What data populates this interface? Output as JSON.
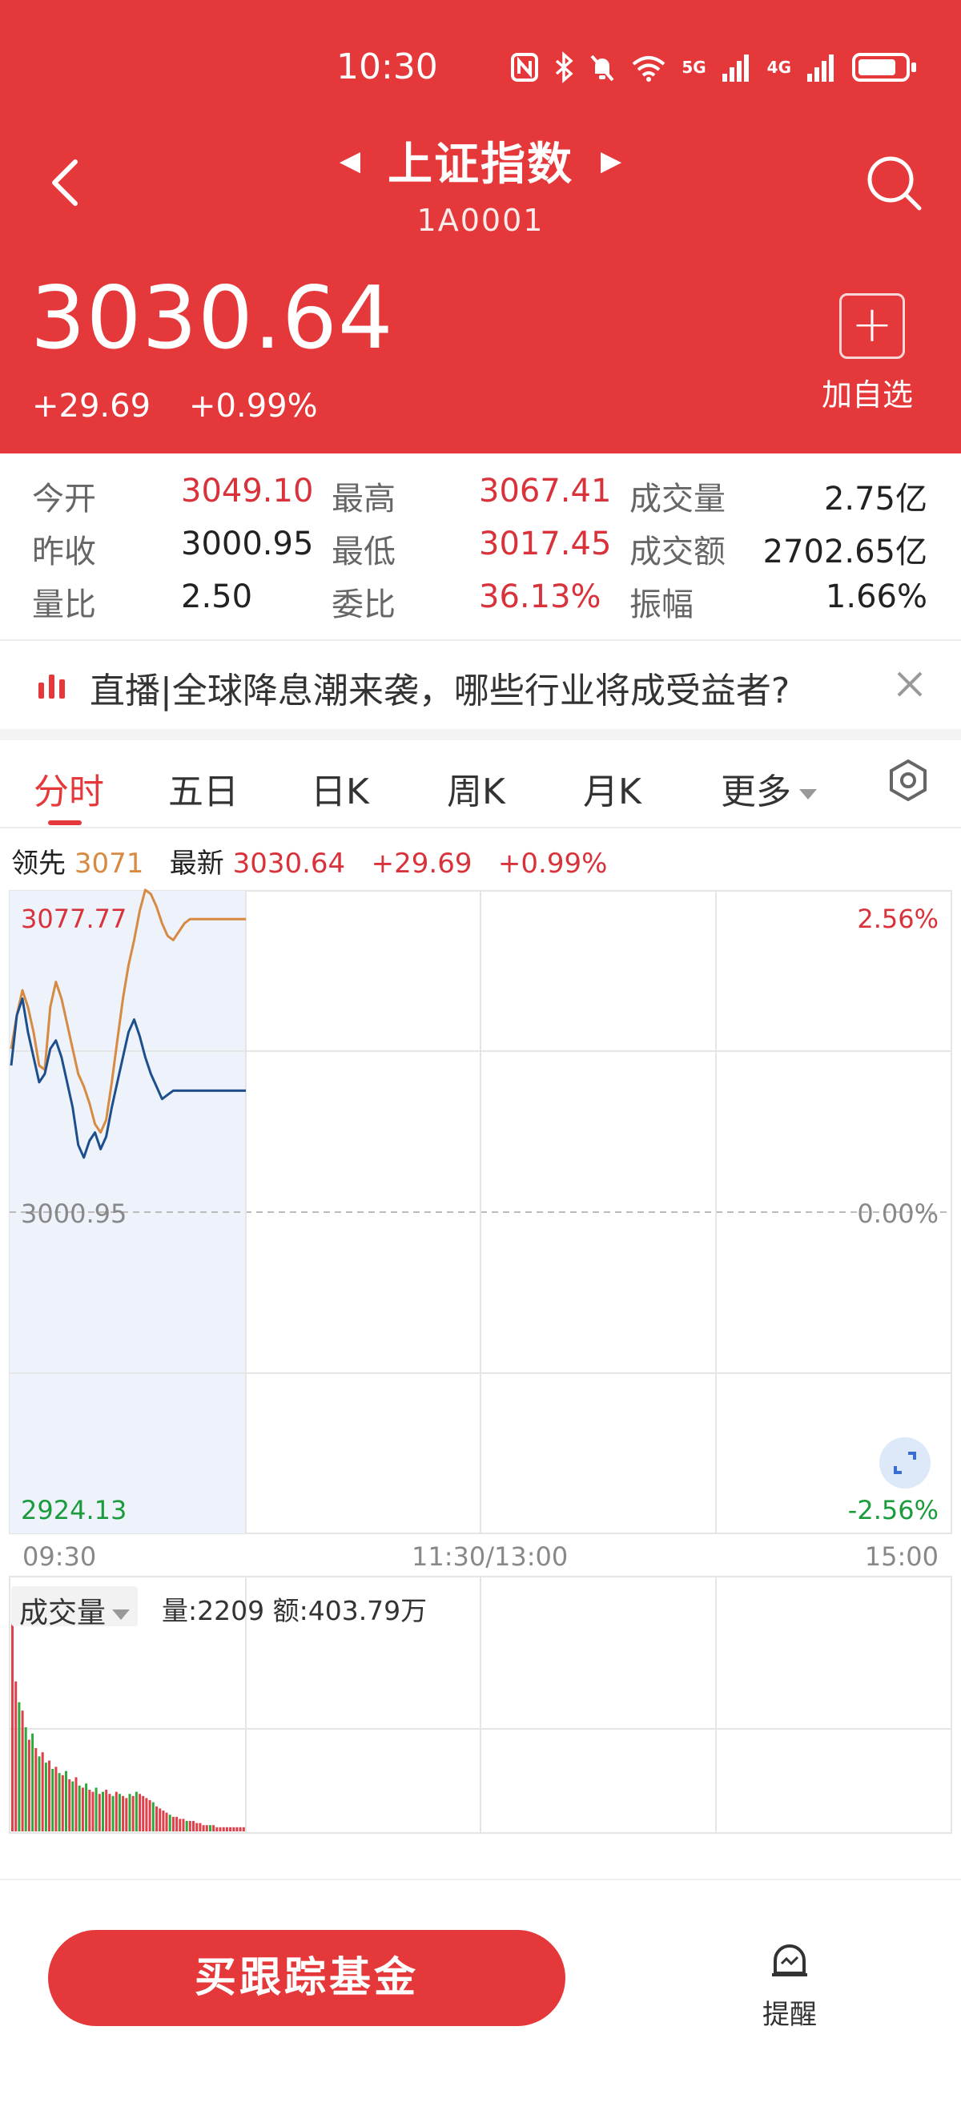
{
  "status_bar": {
    "time": "10:30",
    "icons": [
      "nfc-icon",
      "bluetooth-icon",
      "mute-icon",
      "wifi-icon",
      "5g-signal-icon",
      "4g-signal-icon",
      "battery-icon"
    ],
    "net_labels": [
      "5G",
      "4G"
    ]
  },
  "header": {
    "title": "上证指数",
    "code": "1A0001",
    "price": "3030.64",
    "change": "+29.69",
    "change_pct": "+0.99%",
    "add_label": "加自选",
    "add_symbol": "+"
  },
  "stats": {
    "row1": [
      {
        "label": "今开",
        "value": "3049.10"
      },
      {
        "label": "最高",
        "value": "3067.41"
      },
      {
        "label": "成交量",
        "value": "2.75亿"
      }
    ],
    "row2": [
      {
        "label": "昨收",
        "value": "3000.95"
      },
      {
        "label": "最低",
        "value": "3017.45"
      },
      {
        "label": "成交额",
        "value": "2702.65亿"
      }
    ],
    "row3": [
      {
        "label": "量比",
        "value": "2.50"
      },
      {
        "label": "委比",
        "value": "36.13%"
      },
      {
        "label": "振幅",
        "value": "1.66%"
      }
    ]
  },
  "banner": {
    "text": "直播|全球降息潮来袭，哪些行业将成受益者?"
  },
  "tabs": [
    {
      "label": "分时",
      "active": true
    },
    {
      "label": "五日"
    },
    {
      "label": "日K"
    },
    {
      "label": "周K"
    },
    {
      "label": "月K"
    },
    {
      "label": "更多"
    }
  ],
  "info_line": {
    "leader_label": "领先",
    "leader_value": "3071",
    "latest_label": "最新",
    "latest_value": "3030.64",
    "change": "+29.69",
    "change_pct": "+0.99%"
  },
  "chart_data": [
    {
      "type": "line",
      "y_labels": {
        "top": "3077.77",
        "mid": "3000.95",
        "bottom": "2924.13"
      },
      "y_ylim": [
        2924.13,
        3077.77
      ],
      "pct_labels": {
        "top": "2.56%",
        "mid": "0.00%",
        "bottom": "-2.56%"
      },
      "x_labels": [
        "09:30",
        "11:30/13:00",
        "15:00"
      ],
      "series": [
        {
          "color": "#d68a42",
          "values": [
            3040,
            3048,
            3054,
            3050,
            3044,
            3036,
            3035,
            3050,
            3056,
            3052,
            3046,
            3040,
            3034,
            3031,
            3027,
            3022,
            3020,
            3023,
            3032,
            3042,
            3052,
            3060,
            3066,
            3073,
            3078,
            3077,
            3074,
            3070,
            3067,
            3066,
            3068,
            3070,
            3071,
            3071,
            3071,
            3071,
            3071,
            3071,
            3071,
            3071,
            3071,
            3071,
            3071
          ]
        },
        {
          "color": "#1c4f8c",
          "values": [
            3036,
            3048,
            3052,
            3044,
            3038,
            3032,
            3034,
            3040,
            3042,
            3038,
            3032,
            3026,
            3017,
            3014,
            3018,
            3020,
            3016,
            3019,
            3026,
            3032,
            3038,
            3044,
            3047,
            3043,
            3038,
            3034,
            3031,
            3028,
            3029,
            3030,
            3030,
            3030,
            3030,
            3030,
            3030,
            3030,
            3030,
            3030,
            3030,
            3030,
            3030,
            3030,
            3030
          ]
        }
      ]
    },
    {
      "type": "bar",
      "label": "成交量",
      "info": "量:2209 额:403.79万",
      "values": [
        100,
        72,
        62,
        58,
        50,
        44,
        47,
        40,
        36,
        38,
        33,
        34,
        30,
        31,
        28,
        27,
        29,
        25,
        24,
        26,
        22,
        21,
        23,
        20,
        19,
        21,
        18,
        19,
        20,
        18,
        17,
        19,
        18,
        17,
        16,
        18,
        17,
        19,
        18,
        17,
        16,
        15,
        14,
        12,
        11,
        10,
        9,
        8,
        7,
        7,
        6,
        6,
        5,
        5,
        5,
        4,
        4,
        3,
        3,
        3,
        3,
        2,
        2,
        2,
        2,
        2,
        2,
        2,
        2,
        2
      ],
      "up": [
        1,
        1,
        0,
        1,
        0,
        1,
        0,
        1,
        0,
        1,
        0,
        1,
        0,
        1,
        0,
        1,
        0,
        1,
        0,
        1,
        0,
        1,
        0,
        1,
        1,
        0,
        1,
        0,
        1,
        1,
        0,
        1,
        0,
        1,
        1,
        0,
        1,
        0,
        1,
        1,
        1,
        1,
        0,
        1,
        1,
        1,
        1,
        0,
        1,
        1,
        1,
        1,
        0,
        1,
        1,
        1,
        1,
        1,
        1,
        0,
        1,
        1,
        1,
        1,
        1,
        1,
        1,
        1,
        1,
        1
      ]
    }
  ],
  "bottom": {
    "buy_label": "买跟踪基金",
    "remind_label": "提醒"
  }
}
